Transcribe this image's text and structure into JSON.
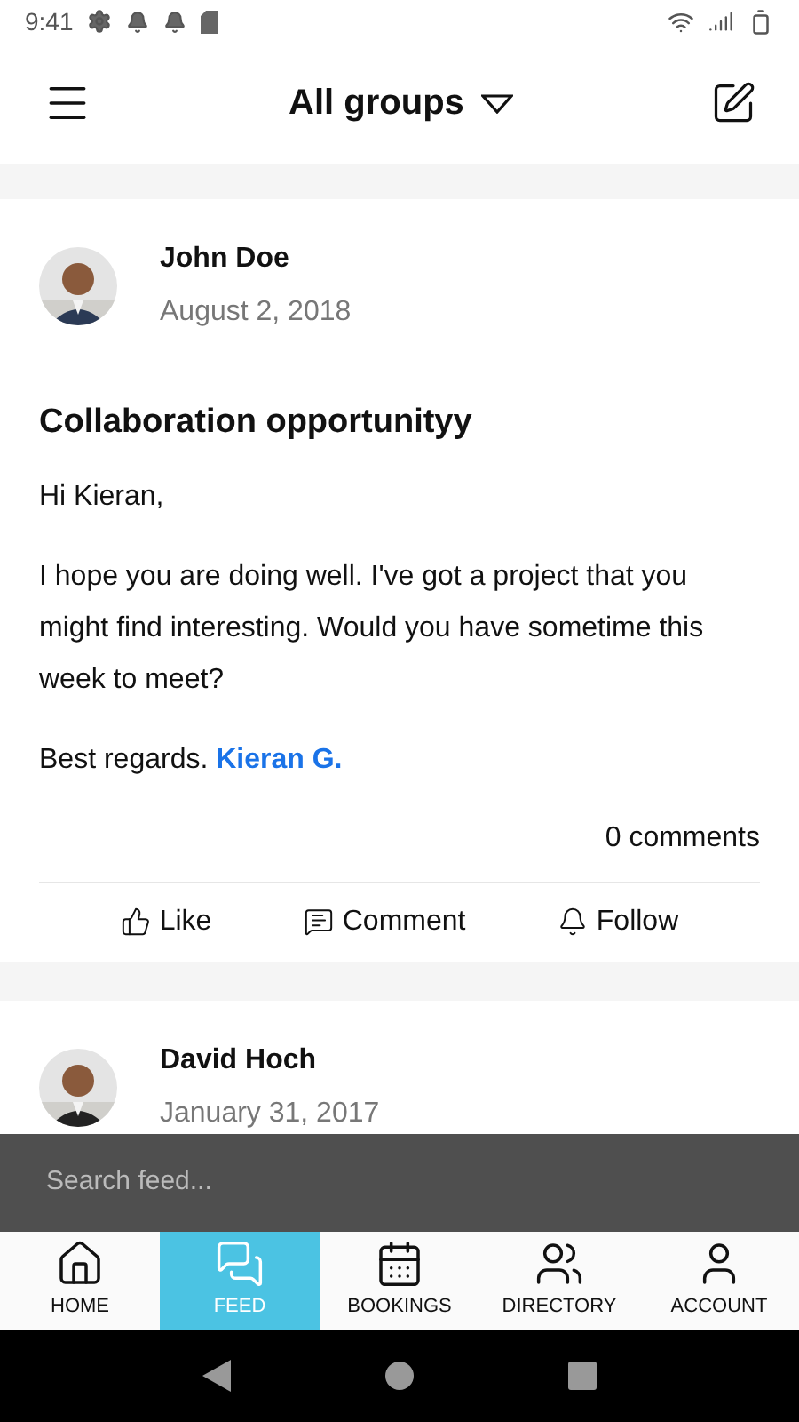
{
  "status_bar": {
    "time": "9:41"
  },
  "header": {
    "title": "All groups"
  },
  "posts": [
    {
      "author": "John Doe",
      "date": "August 2, 2018",
      "title": "Collaboration opportunityy",
      "paragraphs": [
        "Hi Kieran,",
        "I hope you are doing well. I've got a project that you might find interesting. Would you have sometime this week to meet?"
      ],
      "signoff": "Best regards.",
      "signoff_link": "Kieran G.",
      "comments": "0 comments",
      "actions": [
        {
          "kind": "like",
          "label": "Like"
        },
        {
          "kind": "comment",
          "label": "Comment"
        },
        {
          "kind": "follow",
          "label": "Follow"
        }
      ]
    },
    {
      "author": "David Hoch",
      "date": "January 31, 2017"
    }
  ],
  "search": {
    "placeholder": "Search feed..."
  },
  "nav": [
    {
      "kind": "home",
      "label": "HOME",
      "selected": false
    },
    {
      "kind": "feed",
      "label": "FEED",
      "selected": true
    },
    {
      "kind": "bookings",
      "label": "BOOKINGS",
      "selected": false
    },
    {
      "kind": "directory",
      "label": "DIRECTORY",
      "selected": false
    },
    {
      "kind": "account",
      "label": "ACCOUNT",
      "selected": false
    }
  ]
}
